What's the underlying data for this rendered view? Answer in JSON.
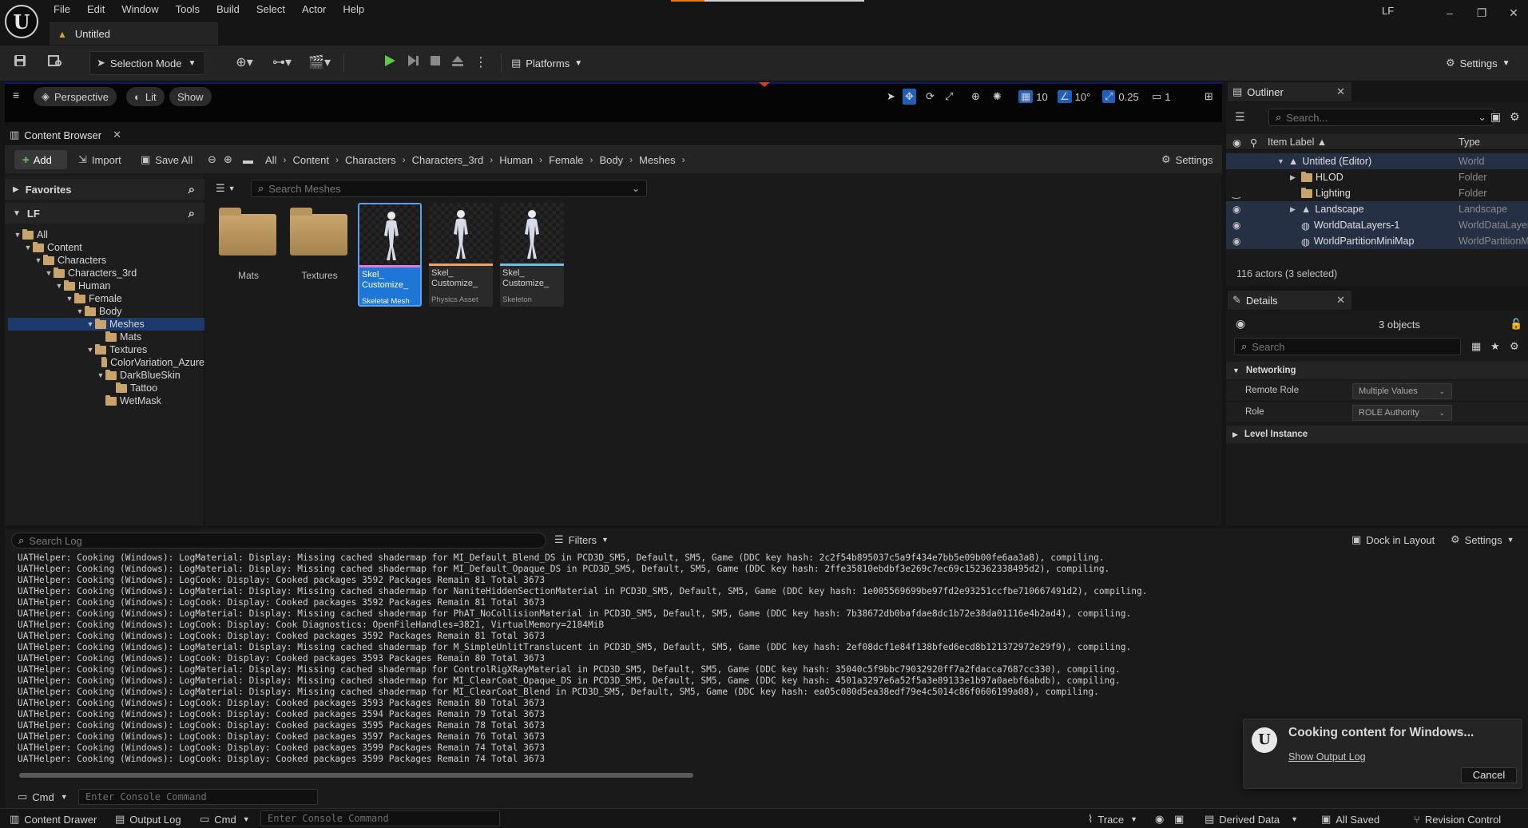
{
  "app": {
    "logo": "U",
    "menu": [
      "File",
      "Edit",
      "Window",
      "Tools",
      "Build",
      "Select",
      "Actor",
      "Help"
    ],
    "document_tab": "Untitled",
    "user": "LF",
    "window_buttons": [
      "–",
      "❐",
      "✕"
    ]
  },
  "toolbar": {
    "selection_mode": "Selection Mode",
    "platforms": "Platforms",
    "settings": "Settings"
  },
  "viewport": {
    "perspective": "Perspective",
    "lit": "Lit",
    "show": "Show",
    "grid_snap": "10",
    "rotation_snap": "10°",
    "scale_snap": "0.25",
    "camera_speed": "1"
  },
  "content_browser": {
    "tab_label": "Content Browser",
    "add": "Add",
    "import": "Import",
    "save_all": "Save All",
    "breadcrumb": [
      "All",
      "Content",
      "Characters",
      "Characters_3rd",
      "Human",
      "Female",
      "Body",
      "Meshes"
    ],
    "settings": "Settings",
    "search_placeholder": "Search Meshes",
    "favorites": "Favorites",
    "root": "LF",
    "tree": [
      {
        "label": "All",
        "depth": 0,
        "open": true
      },
      {
        "label": "Content",
        "depth": 1,
        "open": true
      },
      {
        "label": "Characters",
        "depth": 2,
        "open": true
      },
      {
        "label": "Characters_3rd",
        "depth": 3,
        "open": true
      },
      {
        "label": "Human",
        "depth": 4,
        "open": true
      },
      {
        "label": "Female",
        "depth": 5,
        "open": true
      },
      {
        "label": "Body",
        "depth": 6,
        "open": true
      },
      {
        "label": "Meshes",
        "depth": 7,
        "open": true,
        "selected": true
      },
      {
        "label": "Mats",
        "depth": 8,
        "open": null
      },
      {
        "label": "Textures",
        "depth": 7,
        "open": true
      },
      {
        "label": "ColorVariation_Azure",
        "depth": 8,
        "open": null
      },
      {
        "label": "DarkBlueSkin",
        "depth": 8,
        "open": true
      },
      {
        "label": "Tattoo",
        "depth": 9,
        "open": null
      },
      {
        "label": "WetMask",
        "depth": 8,
        "open": null
      }
    ],
    "folders": [
      "Mats",
      "Textures"
    ],
    "assets": [
      {
        "name_line1": "Skel_",
        "name_line2": "Customize_",
        "kind": "Skeletal Mesh",
        "bar_color": "#e07ad6",
        "selected": true
      },
      {
        "name_line1": "Skel_",
        "name_line2": "Customize_",
        "kind": "Physics Asset",
        "bar_color": "#e8a26a",
        "selected": false
      },
      {
        "name_line1": "Skel_",
        "name_line2": "Customize_",
        "kind": "Skeleton",
        "bar_color": "#6fc0e0",
        "selected": false
      }
    ]
  },
  "outliner": {
    "tab_label": "Outliner",
    "search_placeholder": "Search...",
    "col_label": "Item Label ▲",
    "col_type": "Type",
    "rows": [
      {
        "label": "Untitled (Editor)",
        "type": "World",
        "indent": 1,
        "expander": "▼",
        "selected": true,
        "eye": ""
      },
      {
        "label": "HLOD",
        "type": "Folder",
        "indent": 2,
        "expander": "▶",
        "selected": false,
        "eye": ""
      },
      {
        "label": "Lighting",
        "type": "Folder",
        "indent": 2,
        "expander": "",
        "selected": false,
        "eye": "‿"
      },
      {
        "label": "Landscape",
        "type": "Landscape",
        "indent": 2,
        "expander": "▶",
        "selected": true,
        "eye": "◉"
      },
      {
        "label": "WorldDataLayers-1",
        "type": "WorldDataLayers",
        "indent": 2,
        "expander": "",
        "selected": true,
        "eye": "◉"
      },
      {
        "label": "WorldPartitionMiniMap",
        "type": "WorldPartitionMiniMap",
        "indent": 2,
        "expander": "",
        "selected": true,
        "eye": "◉"
      }
    ],
    "count": "116 actors (3 selected)"
  },
  "details": {
    "tab_label": "Details",
    "objects": "3 objects",
    "search_placeholder": "Search",
    "networking": "Networking",
    "remote_role_label": "Remote Role",
    "remote_role_value": "Multiple Values",
    "role_label": "Role",
    "role_value": "ROLE Authority",
    "level_instance": "Level Instance"
  },
  "output_log": {
    "search_placeholder": "Search Log",
    "filters": "Filters",
    "dock": "Dock in Layout",
    "settings": "Settings",
    "lines": [
      "UATHelper: Cooking (Windows): LogMaterial: Display: Missing cached shadermap for MI_Default_Blend_DS in PCD3D_SM5, Default, SM5, Game (DDC key hash: 2c2f54b895037c5a9f434e7bb5e09b00fe6aa3a8), compiling.",
      "UATHelper: Cooking (Windows): LogMaterial: Display: Missing cached shadermap for MI_Default_Opaque_DS in PCD3D_SM5, Default, SM5, Game (DDC key hash: 2ffe35810ebdbf3e269c7ec69c152362338495d2), compiling.",
      "UATHelper: Cooking (Windows): LogCook: Display: Cooked packages 3592 Packages Remain 81 Total 3673",
      "UATHelper: Cooking (Windows): LogMaterial: Display: Missing cached shadermap for NaniteHiddenSectionMaterial in PCD3D_SM5, Default, SM5, Game (DDC key hash: 1e005569699be97fd2e93251ccfbe710667491d2), compiling.",
      "UATHelper: Cooking (Windows): LogCook: Display: Cooked packages 3592 Packages Remain 81 Total 3673",
      "UATHelper: Cooking (Windows): LogMaterial: Display: Missing cached shadermap for PhAT_NoCollisionMaterial in PCD3D_SM5, Default, SM5, Game (DDC key hash: 7b38672db0bafdae8dc1b72e38da01116e4b2ad4), compiling.",
      "UATHelper: Cooking (Windows): LogCook: Display: Cook Diagnostics: OpenFileHandles=3821, VirtualMemory=2184MiB",
      "UATHelper: Cooking (Windows): LogCook: Display: Cooked packages 3592 Packages Remain 81 Total 3673",
      "UATHelper: Cooking (Windows): LogMaterial: Display: Missing cached shadermap for M_SimpleUnlitTranslucent in PCD3D_SM5, Default, SM5, Game (DDC key hash: 2ef08dcf1e84f138bfed6ecd8b121372972e29f9), compiling.",
      "UATHelper: Cooking (Windows): LogCook: Display: Cooked packages 3593 Packages Remain 80 Total 3673",
      "UATHelper: Cooking (Windows): LogMaterial: Display: Missing cached shadermap for ControlRigXRayMaterial in PCD3D_SM5, Default, SM5, Game (DDC key hash: 35040c5f9bbc79032920ff7a2fdacca7687cc330), compiling.",
      "UATHelper: Cooking (Windows): LogMaterial: Display: Missing cached shadermap for MI_ClearCoat_Opaque_DS in PCD3D_SM5, Default, SM5, Game (DDC key hash: 4501a3297e6a52f5a3e89133e1b97a0aebf6abdb), compiling.",
      "UATHelper: Cooking (Windows): LogMaterial: Display: Missing cached shadermap for MI_ClearCoat_Blend in PCD3D_SM5, Default, SM5, Game (DDC key hash: ea05c080d5ea38edf79e4c5014c86f0606199a08), compiling.",
      "UATHelper: Cooking (Windows): LogCook: Display: Cooked packages 3593 Packages Remain 80 Total 3673",
      "UATHelper: Cooking (Windows): LogCook: Display: Cooked packages 3594 Packages Remain 79 Total 3673",
      "UATHelper: Cooking (Windows): LogCook: Display: Cooked packages 3595 Packages Remain 78 Total 3673",
      "UATHelper: Cooking (Windows): LogCook: Display: Cooked packages 3597 Packages Remain 76 Total 3673",
      "UATHelper: Cooking (Windows): LogCook: Display: Cooked packages 3599 Packages Remain 74 Total 3673",
      "UATHelper: Cooking (Windows): LogCook: Display: Cooked packages 3599 Packages Remain 74 Total 3673"
    ],
    "cmd": "Cmd",
    "cmd_placeholder": "Enter Console Command"
  },
  "toast": {
    "title": "Cooking content for Windows...",
    "link": "Show Output Log",
    "cancel": "Cancel"
  },
  "statusbar": {
    "content_drawer": "Content Drawer",
    "output_log": "Output Log",
    "cmd": "Cmd",
    "cmd_placeholder": "Enter Console Command",
    "trace": "Trace",
    "derived_data": "Derived Data",
    "all_saved": "All Saved",
    "revision_control": "Revision Control"
  },
  "colors": {
    "accent_blue": "#1e76d6",
    "play_green": "#5cc94a",
    "folder": "#c9a66d",
    "tab_orange": "#e0a030"
  }
}
